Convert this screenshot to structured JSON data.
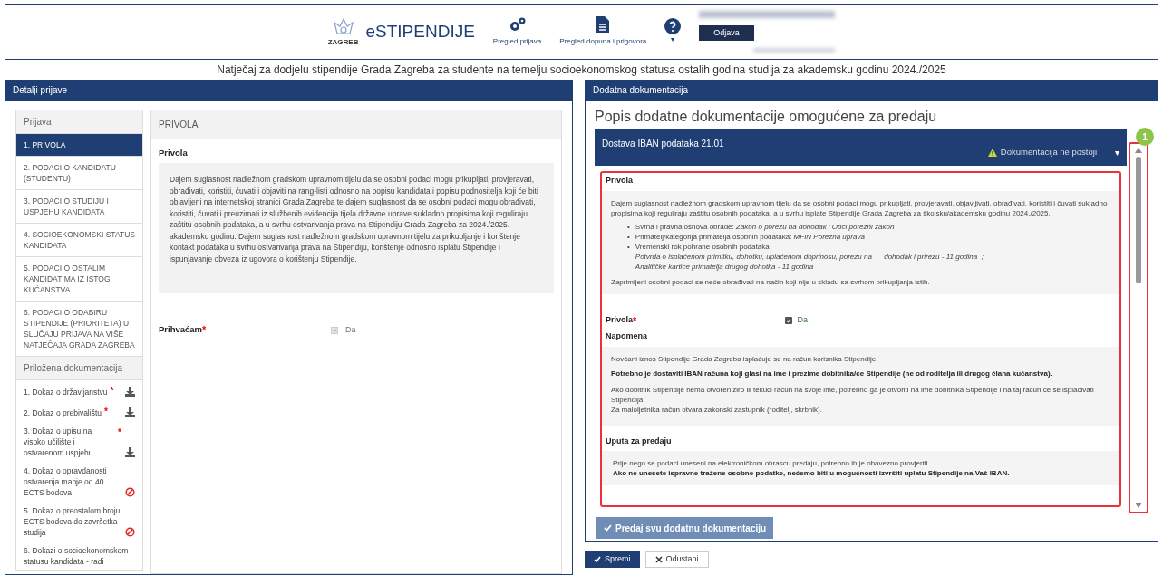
{
  "header": {
    "logo_caption": "ZAGREB",
    "app_title": "eSTIPENDIJE",
    "nav": [
      {
        "kind": "gears",
        "label": "Pregled prijava"
      },
      {
        "kind": "document",
        "label": "Pregled dopuna i prigovora"
      }
    ],
    "help_caret": "▾",
    "logout": "Odjava"
  },
  "page_title": "Natječaj za dodjelu stipendije Grada Zagreba za studente na temelju socioekonomskog statusa ostalih godina studija za akademsku godinu 2024./2025",
  "left": {
    "title": "Detalji prijave",
    "sidebar": {
      "section_title": "Prijava",
      "items": [
        {
          "label": "1. PRIVOLA",
          "selected": true
        },
        {
          "label": "2. PODACI O KANDIDATU (STUDENTU)",
          "selected": false
        },
        {
          "label": "3. PODACI O STUDIJU I USPJEHU KANDIDATA",
          "selected": false
        },
        {
          "label": "4. SOCIOEKONOMSKI STATUS KANDIDATA",
          "selected": false
        },
        {
          "label": "5. PODACI O OSTALIM KANDIDATIMA IZ ISTOG KUĆANSTVA",
          "selected": false
        },
        {
          "label": "6. PODACI O ODABIRU STIPENDIJE (PRIORITETA) U SLUČAJU PRIJAVA NA VIŠE NATJEČAJA GRADA ZAGREBA",
          "selected": false
        }
      ],
      "docs_title": "Priložena dokumentacija",
      "docs": [
        {
          "label": "1. Dokaz o državljanstvu",
          "required_mark": "*",
          "kind": "download"
        },
        {
          "label": "2. Dokaz o prebivalištu",
          "required_mark": "*",
          "kind": "download"
        },
        {
          "label": "3. Dokaz o upisu na visoko učilište i ostvarenom uspjehu",
          "required_mark": "*",
          "kind": "download"
        },
        {
          "label": "4. Dokaz o opravdanosti ostvarenja manje od 40 ECTS bodova",
          "kind": "missing"
        },
        {
          "label": "5. Dokaz o preostalom broju ECTS bodova do završetka studija",
          "kind": "missing"
        },
        {
          "label": "6. Dokazi o socioekonomskom statusu kandidata - radi"
        }
      ]
    },
    "form": {
      "title": "PRIVOLA",
      "section": "Privola",
      "text": "Dajem suglasnost nadležnom gradskom upravnom tijelu da se osobni podaci mogu prikupljati, provjeravati, obrađivati, koristiti, čuvati i objaviti na rang-listi odnosno na popisu kandidata i popisu podnositelja koji će biti objavljeni na internetskoj stranici Grada Zagreba te dajem suglasnost da se osobni podaci mogu obrađivati, koristiti, čuvati i preuzimati iz službenih evidencija tijela državne uprave sukladno propisima koji reguliraju zaštitu osobnih podataka, a u svrhu ostvarivanja prava na Stipendiju Grada Zagreba za 2024./2025. akademsku godinu. Dajem suglasnost nadležnom gradskom upravnom tijelu za prikupljanje i korištenje kontakt podataka u svrhu ostvarivanja prava na Stipendiju, korištenje odnosno isplatu Stipendije i ispunjavanje obveza iz ugovora o korištenju Stipendije.",
      "field_label": "Prihvaćam",
      "required_mark": "*",
      "checkbox": {
        "label": "Da",
        "checked": true,
        "disabled": true
      }
    }
  },
  "right": {
    "title": "Dodatna dokumentacija",
    "heading": "Popis dodatne dokumentacije omogućene za predaju",
    "accordion": {
      "title": "Dostava IBAN podataka 21.01",
      "status": "Dokumentacija ne postoji",
      "caret": "▾",
      "privola_title": "Privola",
      "privola_text": "Dajem suglasnost nadležnom gradskom upravnom tijelu da se osobni podaci mogu prikupljati, provjeravati, objavljivati, obrađivati, koristiti i čuvati sukladno propisima koji reguliraju zaštitu osobnih podataka, a u svrhu isplate Stipendije Grada Zagreba za školsku/akademsku godinu 2024./2025.",
      "bullets": [
        {
          "marker": "•",
          "text": "Svrha i pravna osnova obrade: *Zakon o porezu na dohodak i Opći porezni zakon*"
        },
        {
          "marker": "•",
          "text": "Primatelj/kategorija primatelja osobnih podataka: *MFIN Porezna uprava*"
        },
        {
          "marker": "•",
          "text": "Vremenski rok pohrane osobnih podataka:",
          "details": [
            "Potvrda o isplaćenom primitku, dohotku, uplaćenom doprinosu, porezu na      dohodak i prirezu - 11 godina  ;",
            "Analitičke kartice primatelja drugog dohotka - 11 godina"
          ]
        }
      ],
      "privola_footer": "Zaprimljeni osobni podaci se neće obrađivati na način koji nije u skladu sa svrhom prikupljanja istih.",
      "consent_label": "Privola",
      "consent_required_mark": "*",
      "consent": {
        "label": "Da",
        "checked": true
      },
      "note_title": "Napomena",
      "note_paragraphs": [
        {
          "text": "Novčani iznos Stipendije Grada Zagreba isplaćuje se na račun korisnika Stipendije.",
          "bold": false
        },
        {
          "text": "Potrebno je dostaviti IBAN računa koji glasi na ime i prezime dobitnika/ce Stipendije (ne od roditelja ili drugog člana kućanstva).",
          "bold": true
        },
        {
          "text": "Ako dobitnik Stipendije nema otvoren žiro ili tekući račun na svoje ime, potrebno ga je otvoriti na ime dobitnika Stipendije i na taj račun će se isplaćivati Stipendija.",
          "bold": false
        },
        {
          "text": "Za maloljetnika račun otvara zakonski zastupnik (roditelj, skrbnik).",
          "bold": false
        }
      ],
      "instr_title": "Uputa za predaju",
      "instr_lines": [
        {
          "text": "Prije nego se podaci uneseni na elektroničkom obrascu predaju, potrebno ih je obavezno provjeriti.",
          "bold": false
        },
        {
          "text": "Ako ne unesete ispravne tražene osobne podatke, nećemo biti u mogućnosti izvršiti uplatu Stipendije na Vaš IBAN.",
          "bold": true
        }
      ]
    },
    "submit": "Predaj svu dodatnu dokumentaciju",
    "annotation": "1"
  },
  "footer_buttons": [
    {
      "kind": "primary",
      "label": "Spremi"
    },
    {
      "kind": "secondary",
      "label": "Odustani"
    }
  ]
}
